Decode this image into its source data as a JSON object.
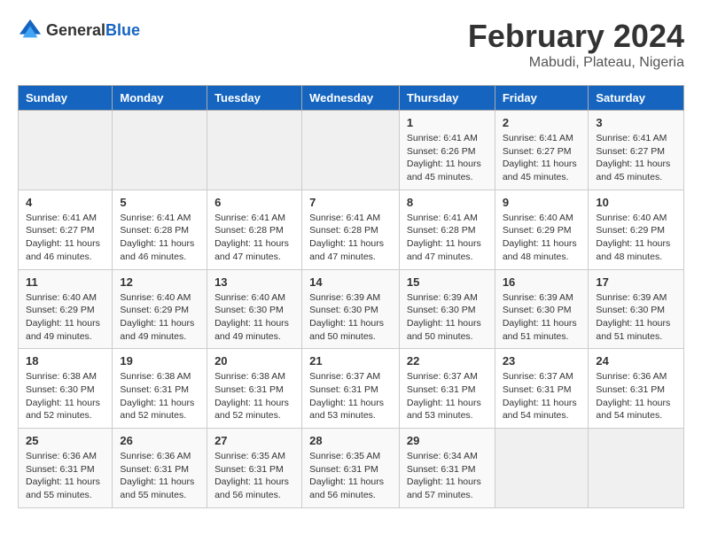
{
  "logo": {
    "text_general": "General",
    "text_blue": "Blue"
  },
  "title": "February 2024",
  "subtitle": "Mabudi, Plateau, Nigeria",
  "days_of_week": [
    "Sunday",
    "Monday",
    "Tuesday",
    "Wednesday",
    "Thursday",
    "Friday",
    "Saturday"
  ],
  "weeks": [
    [
      {
        "day": "",
        "empty": true
      },
      {
        "day": "",
        "empty": true
      },
      {
        "day": "",
        "empty": true
      },
      {
        "day": "",
        "empty": true
      },
      {
        "day": "1",
        "sunrise": "Sunrise: 6:41 AM",
        "sunset": "Sunset: 6:26 PM",
        "daylight": "Daylight: 11 hours and 45 minutes."
      },
      {
        "day": "2",
        "sunrise": "Sunrise: 6:41 AM",
        "sunset": "Sunset: 6:27 PM",
        "daylight": "Daylight: 11 hours and 45 minutes."
      },
      {
        "day": "3",
        "sunrise": "Sunrise: 6:41 AM",
        "sunset": "Sunset: 6:27 PM",
        "daylight": "Daylight: 11 hours and 45 minutes."
      }
    ],
    [
      {
        "day": "4",
        "sunrise": "Sunrise: 6:41 AM",
        "sunset": "Sunset: 6:27 PM",
        "daylight": "Daylight: 11 hours and 46 minutes."
      },
      {
        "day": "5",
        "sunrise": "Sunrise: 6:41 AM",
        "sunset": "Sunset: 6:28 PM",
        "daylight": "Daylight: 11 hours and 46 minutes."
      },
      {
        "day": "6",
        "sunrise": "Sunrise: 6:41 AM",
        "sunset": "Sunset: 6:28 PM",
        "daylight": "Daylight: 11 hours and 47 minutes."
      },
      {
        "day": "7",
        "sunrise": "Sunrise: 6:41 AM",
        "sunset": "Sunset: 6:28 PM",
        "daylight": "Daylight: 11 hours and 47 minutes."
      },
      {
        "day": "8",
        "sunrise": "Sunrise: 6:41 AM",
        "sunset": "Sunset: 6:28 PM",
        "daylight": "Daylight: 11 hours and 47 minutes."
      },
      {
        "day": "9",
        "sunrise": "Sunrise: 6:40 AM",
        "sunset": "Sunset: 6:29 PM",
        "daylight": "Daylight: 11 hours and 48 minutes."
      },
      {
        "day": "10",
        "sunrise": "Sunrise: 6:40 AM",
        "sunset": "Sunset: 6:29 PM",
        "daylight": "Daylight: 11 hours and 48 minutes."
      }
    ],
    [
      {
        "day": "11",
        "sunrise": "Sunrise: 6:40 AM",
        "sunset": "Sunset: 6:29 PM",
        "daylight": "Daylight: 11 hours and 49 minutes."
      },
      {
        "day": "12",
        "sunrise": "Sunrise: 6:40 AM",
        "sunset": "Sunset: 6:29 PM",
        "daylight": "Daylight: 11 hours and 49 minutes."
      },
      {
        "day": "13",
        "sunrise": "Sunrise: 6:40 AM",
        "sunset": "Sunset: 6:30 PM",
        "daylight": "Daylight: 11 hours and 49 minutes."
      },
      {
        "day": "14",
        "sunrise": "Sunrise: 6:39 AM",
        "sunset": "Sunset: 6:30 PM",
        "daylight": "Daylight: 11 hours and 50 minutes."
      },
      {
        "day": "15",
        "sunrise": "Sunrise: 6:39 AM",
        "sunset": "Sunset: 6:30 PM",
        "daylight": "Daylight: 11 hours and 50 minutes."
      },
      {
        "day": "16",
        "sunrise": "Sunrise: 6:39 AM",
        "sunset": "Sunset: 6:30 PM",
        "daylight": "Daylight: 11 hours and 51 minutes."
      },
      {
        "day": "17",
        "sunrise": "Sunrise: 6:39 AM",
        "sunset": "Sunset: 6:30 PM",
        "daylight": "Daylight: 11 hours and 51 minutes."
      }
    ],
    [
      {
        "day": "18",
        "sunrise": "Sunrise: 6:38 AM",
        "sunset": "Sunset: 6:30 PM",
        "daylight": "Daylight: 11 hours and 52 minutes."
      },
      {
        "day": "19",
        "sunrise": "Sunrise: 6:38 AM",
        "sunset": "Sunset: 6:31 PM",
        "daylight": "Daylight: 11 hours and 52 minutes."
      },
      {
        "day": "20",
        "sunrise": "Sunrise: 6:38 AM",
        "sunset": "Sunset: 6:31 PM",
        "daylight": "Daylight: 11 hours and 52 minutes."
      },
      {
        "day": "21",
        "sunrise": "Sunrise: 6:37 AM",
        "sunset": "Sunset: 6:31 PM",
        "daylight": "Daylight: 11 hours and 53 minutes."
      },
      {
        "day": "22",
        "sunrise": "Sunrise: 6:37 AM",
        "sunset": "Sunset: 6:31 PM",
        "daylight": "Daylight: 11 hours and 53 minutes."
      },
      {
        "day": "23",
        "sunrise": "Sunrise: 6:37 AM",
        "sunset": "Sunset: 6:31 PM",
        "daylight": "Daylight: 11 hours and 54 minutes."
      },
      {
        "day": "24",
        "sunrise": "Sunrise: 6:36 AM",
        "sunset": "Sunset: 6:31 PM",
        "daylight": "Daylight: 11 hours and 54 minutes."
      }
    ],
    [
      {
        "day": "25",
        "sunrise": "Sunrise: 6:36 AM",
        "sunset": "Sunset: 6:31 PM",
        "daylight": "Daylight: 11 hours and 55 minutes."
      },
      {
        "day": "26",
        "sunrise": "Sunrise: 6:36 AM",
        "sunset": "Sunset: 6:31 PM",
        "daylight": "Daylight: 11 hours and 55 minutes."
      },
      {
        "day": "27",
        "sunrise": "Sunrise: 6:35 AM",
        "sunset": "Sunset: 6:31 PM",
        "daylight": "Daylight: 11 hours and 56 minutes."
      },
      {
        "day": "28",
        "sunrise": "Sunrise: 6:35 AM",
        "sunset": "Sunset: 6:31 PM",
        "daylight": "Daylight: 11 hours and 56 minutes."
      },
      {
        "day": "29",
        "sunrise": "Sunrise: 6:34 AM",
        "sunset": "Sunset: 6:31 PM",
        "daylight": "Daylight: 11 hours and 57 minutes."
      },
      {
        "day": "",
        "empty": true
      },
      {
        "day": "",
        "empty": true
      }
    ]
  ]
}
